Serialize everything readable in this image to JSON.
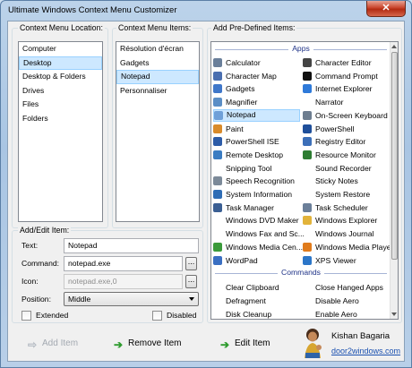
{
  "window": {
    "title": "Ultimate Windows Context Menu Customizer",
    "close_glyph": "✕"
  },
  "locations": {
    "label": "Context Menu Location:",
    "items": [
      "Computer",
      "Desktop",
      "Desktop & Folders",
      "Drives",
      "Files",
      "Folders"
    ],
    "selected": "Desktop"
  },
  "menu_items": {
    "label": "Context Menu Items:",
    "items": [
      "Résolution d'écran",
      "Gadgets",
      "Notepad",
      "Personnaliser"
    ],
    "selected": "Notepad"
  },
  "add_edit": {
    "label": "Add/Edit Item:",
    "text_label": "Text:",
    "text_value": "Notepad",
    "command_label": "Command:",
    "command_value": "notepad.exe",
    "icon_label": "Icon:",
    "icon_value": "notepad.exe,0",
    "browse_label": "...",
    "position_label": "Position:",
    "position_value": "Middle",
    "extended_label": "Extended",
    "disabled_label": "Disabled"
  },
  "predefined": {
    "label": "Add Pre-Defined Items:",
    "apps_header": "Apps",
    "commands_header": "Commands",
    "apps_left": [
      {
        "label": "Calculator",
        "icon": "calculator-icon",
        "color": "#6a7f9a"
      },
      {
        "label": "Character Map",
        "icon": "charmap-icon",
        "color": "#4a6fb0"
      },
      {
        "label": "Gadgets",
        "icon": "gadgets-icon",
        "color": "#3f77c9"
      },
      {
        "label": "Magnifier",
        "icon": "magnifier-icon",
        "color": "#5b8ec6"
      },
      {
        "label": "Notepad",
        "icon": "notepad-icon",
        "color": "#6fa0d8"
      },
      {
        "label": "Paint",
        "icon": "paint-icon",
        "color": "#d98b2b"
      },
      {
        "label": "PowerShell ISE",
        "icon": "powershell-ise-icon",
        "color": "#2d5ca8"
      },
      {
        "label": "Remote Desktop",
        "icon": "remote-desktop-icon",
        "color": "#3a7cc2"
      },
      {
        "label": "Snipping Tool",
        "icon": "",
        "color": ""
      },
      {
        "label": "Speech Recognition",
        "icon": "microphone-icon",
        "color": "#7c8a99"
      },
      {
        "label": "System Information",
        "icon": "system-info-icon",
        "color": "#2f6db5"
      },
      {
        "label": "Task Manager",
        "icon": "task-manager-icon",
        "color": "#3b5f93"
      },
      {
        "label": "Windows DVD Maker",
        "icon": "",
        "color": ""
      },
      {
        "label": "Windows Fax and Sc...",
        "icon": "",
        "color": ""
      },
      {
        "label": "Windows Media Cen...",
        "icon": "media-center-icon",
        "color": "#3b9b3b"
      },
      {
        "label": "WordPad",
        "icon": "wordpad-icon",
        "color": "#3a6fc2"
      }
    ],
    "apps_right": [
      {
        "label": "Character Editor",
        "icon": "character-editor-icon",
        "color": "#444444"
      },
      {
        "label": "Command Prompt",
        "icon": "command-prompt-icon",
        "color": "#111111"
      },
      {
        "label": "Internet Explorer",
        "icon": "internet-explorer-icon",
        "color": "#2f7ad9"
      },
      {
        "label": "Narrator",
        "icon": "",
        "color": ""
      },
      {
        "label": "On-Screen Keyboard",
        "icon": "keyboard-icon",
        "color": "#6d7d8f"
      },
      {
        "label": "PowerShell",
        "icon": "powershell-icon",
        "color": "#1f4f9a"
      },
      {
        "label": "Registry Editor",
        "icon": "registry-editor-icon",
        "color": "#3c6fb8"
      },
      {
        "label": "Resource Monitor",
        "icon": "resource-monitor-icon",
        "color": "#2e7d32"
      },
      {
        "label": "Sound Recorder",
        "icon": "",
        "color": ""
      },
      {
        "label": "Sticky Notes",
        "icon": "",
        "color": ""
      },
      {
        "label": "System Restore",
        "icon": "",
        "color": ""
      },
      {
        "label": "Task Scheduler",
        "icon": "task-scheduler-icon",
        "color": "#6b7f99"
      },
      {
        "label": "Windows Explorer",
        "icon": "folder-icon",
        "color": "#e2b33a"
      },
      {
        "label": "Windows Journal",
        "icon": "",
        "color": ""
      },
      {
        "label": "Windows Media Player",
        "icon": "media-player-icon",
        "color": "#e07b1c"
      },
      {
        "label": "XPS Viewer",
        "icon": "xps-viewer-icon",
        "color": "#2c76c8"
      }
    ],
    "commands_left": [
      "Clear Clipboard",
      "Defragment",
      "Disk Cleanup"
    ],
    "commands_right": [
      "Close Hanged Apps",
      "Disable Aero",
      "Enable Aero"
    ],
    "selected": "Notepad"
  },
  "actions": {
    "add": "Add Item",
    "remove": "Remove Item",
    "edit": "Edit Item"
  },
  "author": {
    "name": "Kishan Bagaria",
    "link": "door2windows.com"
  },
  "colors": {
    "accent_green": "#2e9b2e",
    "disabled_arrow": "#b6bcc4",
    "header_blue": "#1e3287"
  }
}
